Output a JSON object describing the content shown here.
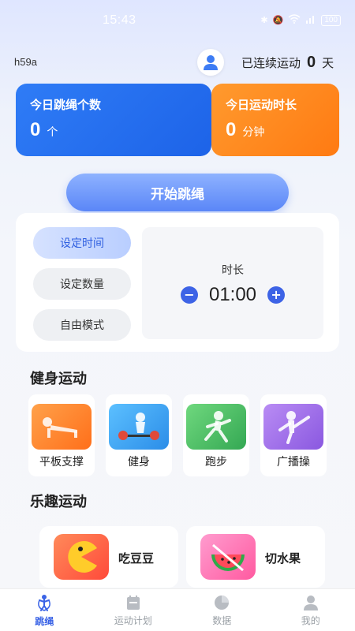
{
  "status_bar": {
    "time": "15:43",
    "battery": "100"
  },
  "header": {
    "username": "h59a",
    "streak_prefix": "已连续运动",
    "streak_days": "0",
    "streak_unit": "天"
  },
  "stats": {
    "jump_count": {
      "title": "今日跳绳个数",
      "value": "0",
      "unit": "个"
    },
    "duration": {
      "title": "今日运动时长",
      "value": "0",
      "unit": "分钟"
    }
  },
  "start_button": "开始跳绳",
  "modes": [
    "设定时间",
    "设定数量",
    "自由模式"
  ],
  "active_mode": 0,
  "timer": {
    "label": "时长",
    "value": "01:00",
    "minus": "−",
    "plus": "+"
  },
  "fitness": {
    "title": "健身运动",
    "items": [
      {
        "label": "平板支撑",
        "color": "#ff8a2a"
      },
      {
        "label": "健身",
        "color": "#3aa2f0"
      },
      {
        "label": "跑步",
        "color": "#4fbf6a"
      },
      {
        "label": "广播操",
        "color": "#9b6ce8"
      }
    ]
  },
  "fun": {
    "title": "乐趣运动",
    "items": [
      {
        "label": "吃豆豆",
        "color": "#ff6a3a"
      },
      {
        "label": "切水果",
        "color": "#ff70b0"
      }
    ]
  },
  "tabs": [
    "跳绳",
    "运动计划",
    "数据",
    "我的"
  ],
  "active_tab": 0,
  "colors": {
    "primary": "#3a63e6",
    "blue_card": "#2f7cf6",
    "orange_card": "#ff8a1f"
  }
}
